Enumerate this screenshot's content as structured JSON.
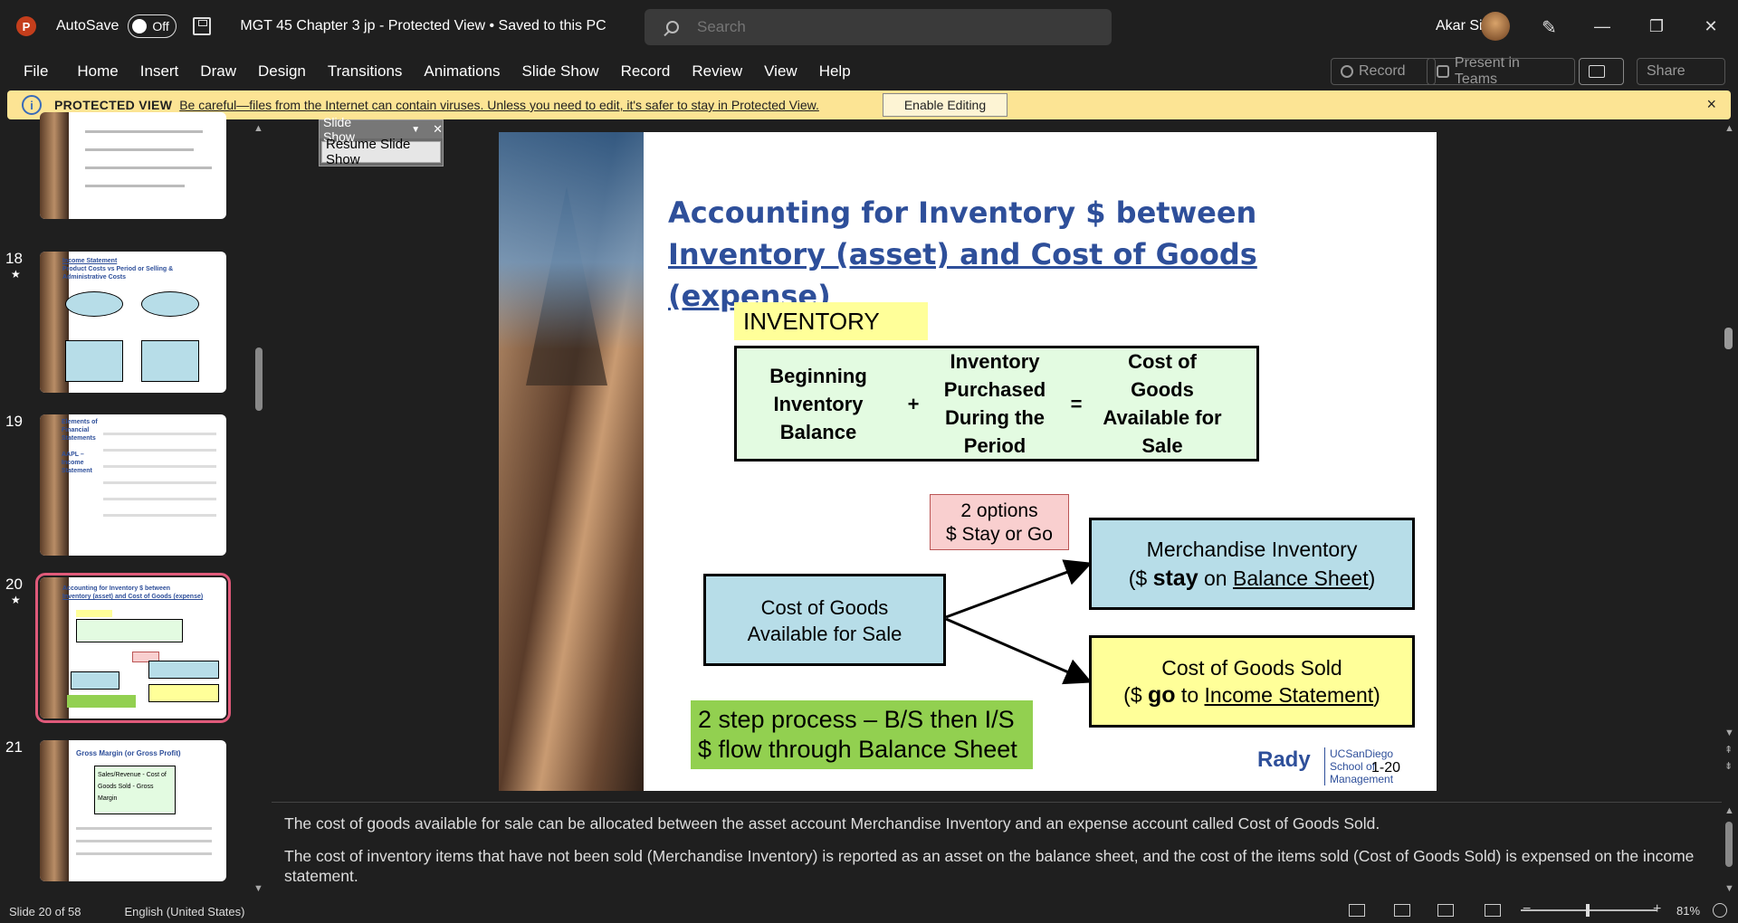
{
  "titlebar": {
    "app_icon": "P",
    "autosave_label": "AutoSave",
    "autosave_state": "Off",
    "document_title": "MGT 45 Chapter 3 jp  -  Protected View • Saved to this PC",
    "search_placeholder": "Search",
    "user_name": "Akar Singh",
    "pen_icon": "✎",
    "minimize": "—",
    "restore": "❐",
    "close": "✕"
  },
  "menu": [
    "File",
    "Home",
    "Insert",
    "Draw",
    "Design",
    "Transitions",
    "Animations",
    "Slide Show",
    "Record",
    "Review",
    "View",
    "Help"
  ],
  "ribbon_right": {
    "record": "Record",
    "present": "Present in Teams",
    "share": "Share"
  },
  "protected_view": {
    "title": "PROTECTED VIEW",
    "message": "Be careful—files from the Internet can contain viruses. Unless you need to edit, it's safer to stay in Protected View.",
    "button": "Enable Editing",
    "close": "×"
  },
  "thumbnails": [
    {
      "number": "18",
      "star": "★",
      "title": "Income Statement",
      "subtitle": "Product Costs vs Period or Selling & Administrative Costs"
    },
    {
      "number": "19",
      "star": "",
      "title": "Elements of Financial Statements",
      "subtitle": "AAPL – Income Statement"
    },
    {
      "number": "20",
      "star": "★",
      "title": "Accounting for Inventory $ between",
      "subtitle": "Inventory (asset) and Cost of Goods (expense)"
    },
    {
      "number": "21",
      "star": "",
      "title": "Gross Margin (or Gross Profit)",
      "subtitle": "Sales/Revenue - Cost of Goods Sold - Gross Margin"
    }
  ],
  "slide_show_toolbar": {
    "title": "Slide Show",
    "resume": "Resume Slide Show"
  },
  "slide": {
    "title_line1": "Accounting for Inventory $ between",
    "title_line2": "Inventory (asset) and Cost of Goods (expense)",
    "inventory_label": "INVENTORY",
    "eq_c1": "Beginning Inventory Balance",
    "eq_plus": "+",
    "eq_c2": "Inventory Purchased During the Period",
    "eq_equals": "=",
    "eq_c3": "Cost of Goods Available for Sale",
    "options_line1": "2 options",
    "options_line2": "$ Stay or Go",
    "cogs_line1": "Cost of Goods",
    "cogs_line2": "Available for Sale",
    "merch_line1": "Merchandise Inventory",
    "merch_open": "($ ",
    "merch_stay": "stay",
    "merch_on": " on ",
    "merch_bs": "Balance Sheet",
    "merch_close": ")",
    "sold_line1": "Cost of Goods Sold",
    "sold_open": "($ ",
    "sold_go": "go",
    "sold_to": " to ",
    "sold_is": "Income Statement",
    "sold_close": ")",
    "step_line1": "2 step process – B/S then I/S",
    "step_line2": "$ flow through Balance Sheet",
    "logo_rady": "Rady",
    "logo_ucsd_1": "UCSanDiego",
    "logo_ucsd_2": "School of Management",
    "slide_number": "1-20"
  },
  "notes": {
    "p1": "The cost of goods available for sale can be allocated between the asset account Merchandise Inventory and an expense account called Cost of Goods Sold.",
    "p2": "The cost of inventory items that have not been sold (Merchandise Inventory) is reported as an asset on the balance sheet, and the cost of the items sold (Cost of Goods Sold) is expensed on the income statement."
  },
  "status": {
    "slide_of": "Slide 20 of 58",
    "language": "English (United States)",
    "zoom_minus": "−",
    "zoom_plus": "+",
    "zoom": "81%"
  }
}
